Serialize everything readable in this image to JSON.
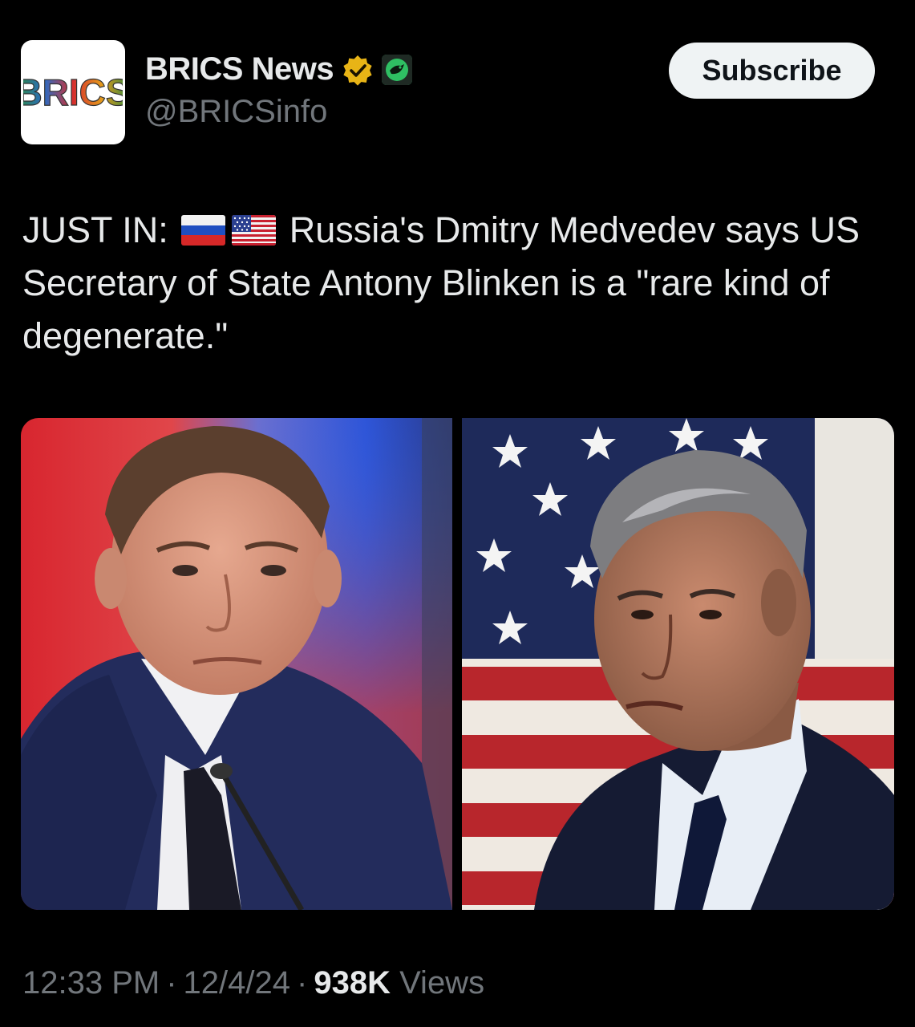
{
  "header": {
    "avatar_text": "BRICS",
    "display_name": "BRICS News",
    "handle": "@BRICSinfo",
    "subscribe_label": "Subscribe",
    "verified_icon": "verified-badge-gold",
    "affiliate_icon": "affiliate-badge"
  },
  "post": {
    "prefix": "JUST IN:",
    "flags": [
      "russia-flag",
      "usa-flag"
    ],
    "text": "Russia's Dmitry Medvedev says US Secretary of State Antony Blinken is a \"rare kind of degenerate.\""
  },
  "media": {
    "photos": [
      "medvedev-photo",
      "blinken-photo"
    ]
  },
  "meta": {
    "time": "12:33 PM",
    "date": "12/4/24",
    "views_count": "938K",
    "views_label": "Views",
    "separator": "·"
  },
  "colors": {
    "background": "#000000",
    "text_primary": "#e7e9ea",
    "text_secondary": "#71767b",
    "button_bg": "#eff3f4",
    "verified_gold": "#e8b416"
  }
}
